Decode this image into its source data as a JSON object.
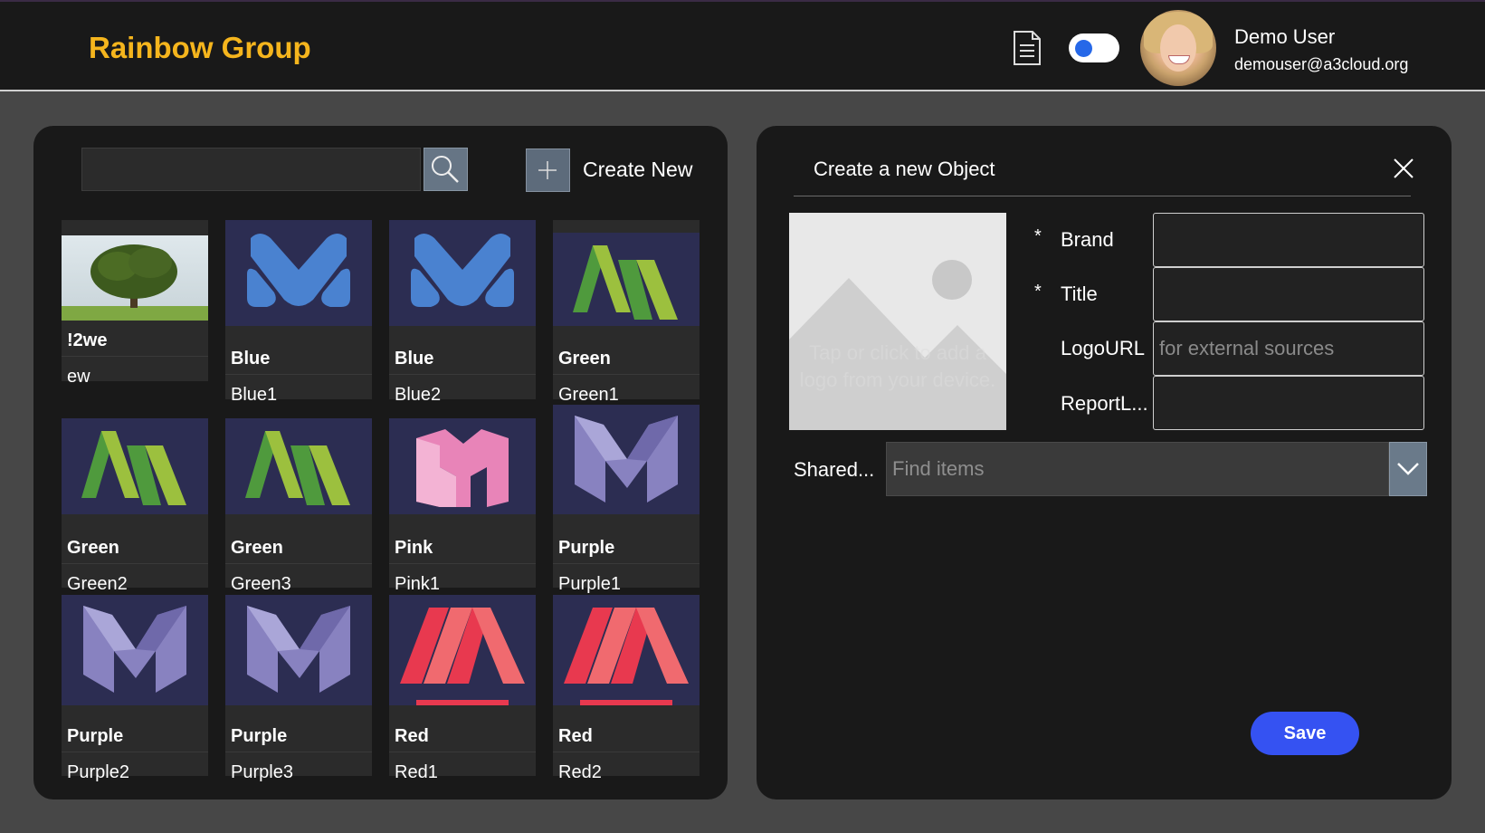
{
  "header": {
    "title": "Rainbow Group",
    "user_name": "Demo User",
    "user_email": "demouser@a3cloud.org",
    "icons": [
      "document-icon",
      "theme-toggle",
      "avatar"
    ]
  },
  "gallery": {
    "search_value": "",
    "create_label": "Create New",
    "items": [
      {
        "brand": "!2we",
        "title": "ew",
        "logo": "tree-photo"
      },
      {
        "brand": "Blue",
        "title": "Blue1",
        "logo": "blue-m"
      },
      {
        "brand": "Blue",
        "title": "Blue2",
        "logo": "blue-m"
      },
      {
        "brand": "Green",
        "title": "Green1",
        "logo": "green-m"
      },
      {
        "brand": "Green",
        "title": "Green2",
        "logo": "green-m"
      },
      {
        "brand": "Green",
        "title": "Green3",
        "logo": "green-m"
      },
      {
        "brand": "Pink",
        "title": "Pink1",
        "logo": "pink-m"
      },
      {
        "brand": "Purple",
        "title": "Purple1",
        "logo": "purple-m"
      },
      {
        "brand": "Purple",
        "title": "Purple2",
        "logo": "purple-m"
      },
      {
        "brand": "Purple",
        "title": "Purple3",
        "logo": "purple-m"
      },
      {
        "brand": "Red",
        "title": "Red1",
        "logo": "red-m"
      },
      {
        "brand": "Red",
        "title": "Red2",
        "logo": "red-m"
      }
    ]
  },
  "form": {
    "title": "Create a new Object",
    "image_hint": "Tap or click to add a logo from your device.",
    "required_marker": "*",
    "fields": [
      {
        "label": "Brand",
        "value": "",
        "placeholder": ""
      },
      {
        "label": "Title",
        "value": "",
        "placeholder": ""
      },
      {
        "label": "LogoURL",
        "value": "",
        "placeholder": "for external sources"
      },
      {
        "label": "ReportL...",
        "value": "",
        "placeholder": ""
      }
    ],
    "shared_label": "Shared...",
    "shared_placeholder": "Find items",
    "save_label": "Save"
  },
  "colors": {
    "brand_title": "#f5b51d",
    "save_button": "#3552f2",
    "toggle_knob": "#2668e8"
  }
}
